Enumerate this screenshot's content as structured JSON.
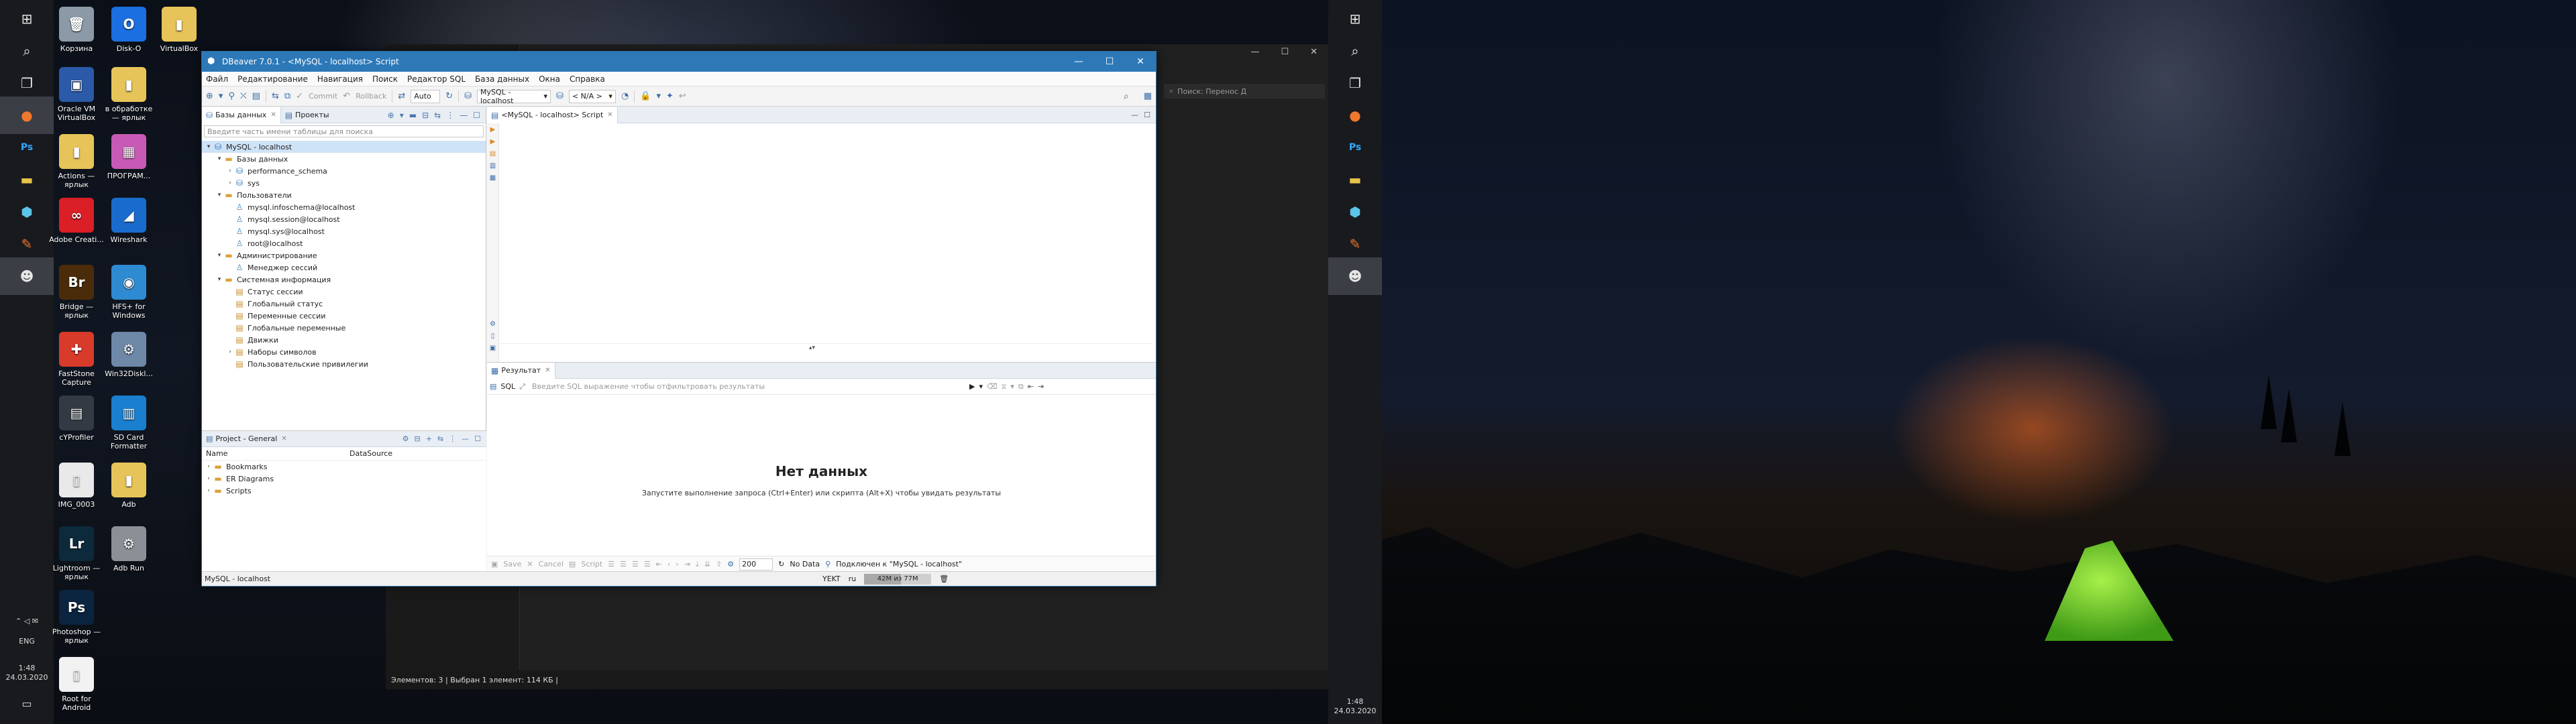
{
  "desktop": {
    "icons": [
      {
        "label": "Корзина",
        "icon": "recycle-bin-icon",
        "color": "#8c9aa8",
        "glyph": "🗑"
      },
      {
        "label": "Disk-O",
        "icon": "disk-o-icon",
        "color": "#1b6fe0",
        "glyph": "O"
      },
      {
        "label": "VirtualBox",
        "icon": "virtualbox-folder-icon",
        "color": "#e7c45a",
        "glyph": "▮"
      },
      {
        "label": "Oracle VM VirtualBox",
        "icon": "virtualbox-icon",
        "color": "#2a5aa8",
        "glyph": "▣"
      },
      {
        "label": "в обработке — ярлык",
        "icon": "folder-shortcut-icon",
        "color": "#e7c45a",
        "glyph": "▮"
      },
      {
        "label": "Actions — ярлык",
        "icon": "folder-shortcut-icon",
        "color": "#e7c45a",
        "glyph": "▮"
      },
      {
        "label": "ПРОГРАМ...",
        "icon": "programs-folder-icon",
        "color": "#c75ab4",
        "glyph": "▦"
      },
      {
        "label": "Adobe Creati...",
        "icon": "adobe-cc-icon",
        "color": "#da1f26",
        "glyph": "∞"
      },
      {
        "label": "Wireshark",
        "icon": "wireshark-icon",
        "color": "#1a6ccc",
        "glyph": "◢"
      },
      {
        "label": "Bridge — ярлык",
        "icon": "bridge-icon",
        "color": "#4b2c0a",
        "glyph": "Br"
      },
      {
        "label": "HFS+ for Windows",
        "icon": "hfs-icon",
        "color": "#2e8bd1",
        "glyph": "◉"
      },
      {
        "label": "FastStone Capture",
        "icon": "faststone-icon",
        "color": "#d93b2b",
        "glyph": "✚"
      },
      {
        "label": "Win32Diskl...",
        "icon": "win32disk-icon",
        "color": "#6e88a8",
        "glyph": "⚙"
      },
      {
        "label": "cYProfiler",
        "icon": "profiler-icon",
        "color": "#333a44",
        "glyph": "▤"
      },
      {
        "label": "SD Card Formatter",
        "icon": "sdcard-icon",
        "color": "#1a7fcf",
        "glyph": "▥"
      },
      {
        "label": "IMG_0003",
        "icon": "image-file-icon",
        "color": "#e9e9e9",
        "glyph": "▯"
      },
      {
        "label": "Adb",
        "icon": "adb-folder-icon",
        "color": "#e7c45a",
        "glyph": "▮"
      },
      {
        "label": "Lightroom — ярлык",
        "icon": "lightroom-icon",
        "color": "#0d2a3d",
        "glyph": "Lr"
      },
      {
        "label": "Adb Run",
        "icon": "adb-run-icon",
        "color": "#8b9096",
        "glyph": "⚙"
      },
      {
        "label": "Photoshop — ярлык",
        "icon": "photoshop-icon",
        "color": "#0b2440",
        "glyph": "Ps"
      },
      {
        "label": "Root for Android",
        "icon": "document-icon",
        "color": "#f2f2f2",
        "glyph": "▯"
      }
    ],
    "tray": {
      "time": "1:48",
      "date": "24.03.2020",
      "lang": "ENG"
    }
  },
  "explorer": {
    "status": "Элементов: 3  |  Выбран 1 элемент: 114 КБ  |",
    "search_placeholder": "Поиск: Перенос Д"
  },
  "dbeaver": {
    "title": "DBeaver 7.0.1 - <MySQL - localhost> Script",
    "menu": [
      "Файл",
      "Редактирование",
      "Навигация",
      "Поиск",
      "Редактор SQL",
      "База данных",
      "Окна",
      "Справка"
    ],
    "toolbar": {
      "commit": "Commit",
      "rollback": "Rollback",
      "mode": "Auto",
      "datasource": "MySQL - localhost",
      "schema": "< N/A >"
    },
    "left_tabs": {
      "databases": "Базы данных",
      "projects": "Проекты"
    },
    "filter_placeholder": "Введите часть имени таблицы для поиска",
    "tree": [
      {
        "label": "MySQL - localhost",
        "level": 0,
        "arrow": "▾",
        "icon": "database-connection-icon",
        "glyph": "⛁",
        "cls": "ic-db",
        "sel": true
      },
      {
        "label": "Базы данных",
        "level": 1,
        "arrow": "▾",
        "icon": "folder-icon",
        "glyph": "▬",
        "cls": "ic-folder"
      },
      {
        "label": "performance_schema",
        "level": 2,
        "arrow": "›",
        "icon": "database-icon",
        "glyph": "⛁",
        "cls": "ic-db"
      },
      {
        "label": "sys",
        "level": 2,
        "arrow": "›",
        "icon": "database-icon",
        "glyph": "⛁",
        "cls": "ic-db"
      },
      {
        "label": "Пользователи",
        "level": 1,
        "arrow": "▾",
        "icon": "folder-icon",
        "glyph": "▬",
        "cls": "ic-folder"
      },
      {
        "label": "mysql.infoschema@localhost",
        "level": 2,
        "arrow": "",
        "icon": "user-icon",
        "glyph": "♙",
        "cls": "ic-user"
      },
      {
        "label": "mysql.session@localhost",
        "level": 2,
        "arrow": "",
        "icon": "user-icon",
        "glyph": "♙",
        "cls": "ic-user"
      },
      {
        "label": "mysql.sys@localhost",
        "level": 2,
        "arrow": "",
        "icon": "user-icon",
        "glyph": "♙",
        "cls": "ic-user"
      },
      {
        "label": "root@localhost",
        "level": 2,
        "arrow": "",
        "icon": "user-icon",
        "glyph": "♙",
        "cls": "ic-user"
      },
      {
        "label": "Администрирование",
        "level": 1,
        "arrow": "▾",
        "icon": "folder-icon",
        "glyph": "▬",
        "cls": "ic-folder"
      },
      {
        "label": "Менеджер сессий",
        "level": 2,
        "arrow": "",
        "icon": "session-manager-icon",
        "glyph": "♙",
        "cls": "ic-user"
      },
      {
        "label": "Системная информация",
        "level": 1,
        "arrow": "▾",
        "icon": "folder-icon",
        "glyph": "▬",
        "cls": "ic-folder"
      },
      {
        "label": "Статус сессии",
        "level": 2,
        "arrow": "",
        "icon": "info-table-icon",
        "glyph": "▤",
        "cls": "ic-info"
      },
      {
        "label": "Глобальный статус",
        "level": 2,
        "arrow": "",
        "icon": "info-table-icon",
        "glyph": "▤",
        "cls": "ic-info"
      },
      {
        "label": "Переменные сессии",
        "level": 2,
        "arrow": "",
        "icon": "info-table-icon",
        "glyph": "▤",
        "cls": "ic-info"
      },
      {
        "label": "Глобальные переменные",
        "level": 2,
        "arrow": "",
        "icon": "info-table-icon",
        "glyph": "▤",
        "cls": "ic-info"
      },
      {
        "label": "Движки",
        "level": 2,
        "arrow": "",
        "icon": "info-table-icon",
        "glyph": "▤",
        "cls": "ic-info"
      },
      {
        "label": "Наборы символов",
        "level": 2,
        "arrow": "›",
        "icon": "info-table-icon",
        "glyph": "▤",
        "cls": "ic-info"
      },
      {
        "label": "Пользовательские привилегии",
        "level": 2,
        "arrow": "",
        "icon": "info-table-icon",
        "glyph": "▤",
        "cls": "ic-info"
      }
    ],
    "project": {
      "title": "Project - General",
      "col_name": "Name",
      "col_ds": "DataSource",
      "items": [
        "Bookmarks",
        "ER Diagrams",
        "Scripts"
      ]
    },
    "editor_tab": "<MySQL - localhost> Script",
    "results": {
      "tab": "Результат",
      "sql_label": "SQL",
      "filter_placeholder": "Введите SQL выражение чтобы отфильтровать результаты",
      "empty_title": "Нет данных",
      "empty_hint": "Запустите выполнение запроса (Ctrl+Enter) или скрипта (Alt+X) чтобы увидать результаты",
      "save": "Save",
      "cancel": "Cancel",
      "script": "Script",
      "fetch_size": "200",
      "no_data": "No Data",
      "connected": "Подключен к \"MySQL - localhost\""
    },
    "statusbar": {
      "left": "MySQL - localhost",
      "tz": "YEKT",
      "locale": "ru",
      "memory": "42M из 77M",
      "memory_fraction": 0.55
    }
  },
  "mon2": {
    "time": "1:48",
    "date": "24.03.2020"
  }
}
